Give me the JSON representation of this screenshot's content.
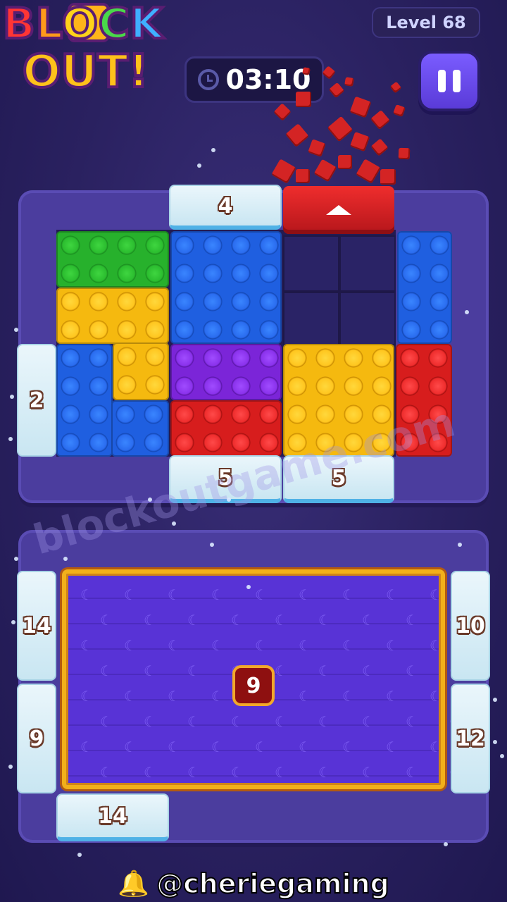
{
  "logo": {
    "line1": [
      "B",
      "L",
      "O",
      "C",
      "K"
    ],
    "line2": "OUT!"
  },
  "header": {
    "level": "Level 68",
    "timer": "03:10",
    "pause_icon": "pause-icon"
  },
  "board_top": {
    "gates": {
      "top_left": "4",
      "left": "2",
      "bottom_left": "5",
      "bottom_right": "5"
    },
    "exit_gate_icon": "arrow-up-icon"
  },
  "board_bottom": {
    "gates": {
      "left_top": "14",
      "left_bottom": "9",
      "right_top": "10",
      "right_bottom": "12",
      "bottom": "14"
    },
    "center_token": "9"
  },
  "watermark": "blockoutgame.com",
  "credit": {
    "handle": "@cheriegaming",
    "icon": "bell-icon"
  }
}
